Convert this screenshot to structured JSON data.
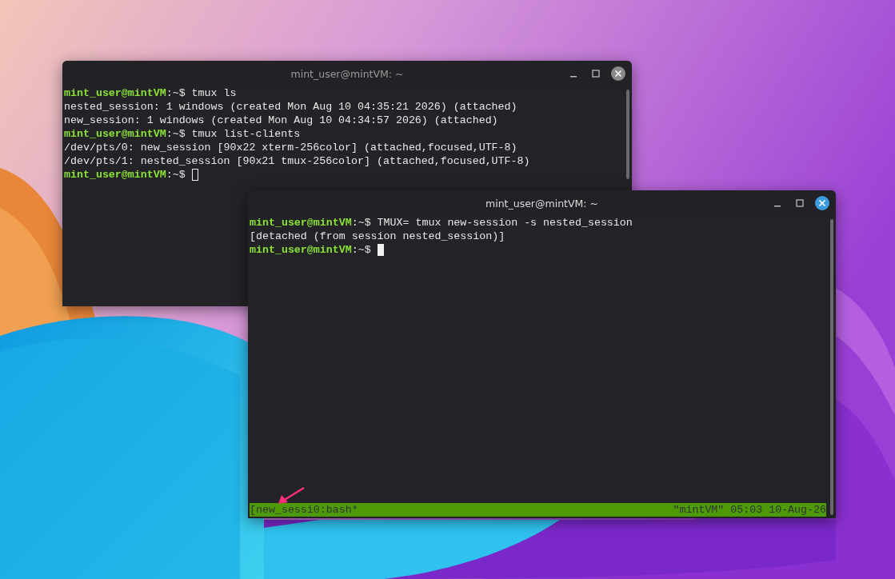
{
  "windows": [
    {
      "title": "mint_user@mintVM: ~",
      "focused": false,
      "lines": [
        {
          "kind": "prompt",
          "user": "mint_user@mintVM",
          "path": ":~$",
          "command": " tmux ls"
        },
        {
          "kind": "output",
          "text": "nested_session: 1 windows (created Mon Aug 10 04:35:21 2026) (attached)"
        },
        {
          "kind": "output",
          "text": "new_session: 1 windows (created Mon Aug 10 04:34:57 2026) (attached)"
        },
        {
          "kind": "prompt",
          "user": "mint_user@mintVM",
          "path": ":~$",
          "command": " tmux list-clients"
        },
        {
          "kind": "output",
          "text": "/dev/pts/0: new_session [90x22 xterm-256color] (attached,focused,UTF-8)"
        },
        {
          "kind": "output",
          "text": "/dev/pts/1: nested_session [90x21 tmux-256color] (attached,focused,UTF-8)"
        },
        {
          "kind": "prompt",
          "user": "mint_user@mintVM",
          "path": ":~$",
          "cursor": true
        }
      ]
    },
    {
      "title": "mint_user@mintVM: ~",
      "focused": true,
      "lines": [
        {
          "kind": "prompt",
          "user": "mint_user@mintVM",
          "path": ":~$",
          "command": " TMUX= tmux new-session -s nested_session"
        },
        {
          "kind": "output",
          "text": "[detached (from session nested_session)]"
        },
        {
          "kind": "prompt",
          "user": "mint_user@mintVM",
          "path": ":~$",
          "cursor": true
        }
      ],
      "status_bar": {
        "left": "[new_sessi0:bash*",
        "right": "\"mintVM\" 05:03 10-Aug-26"
      }
    }
  ]
}
